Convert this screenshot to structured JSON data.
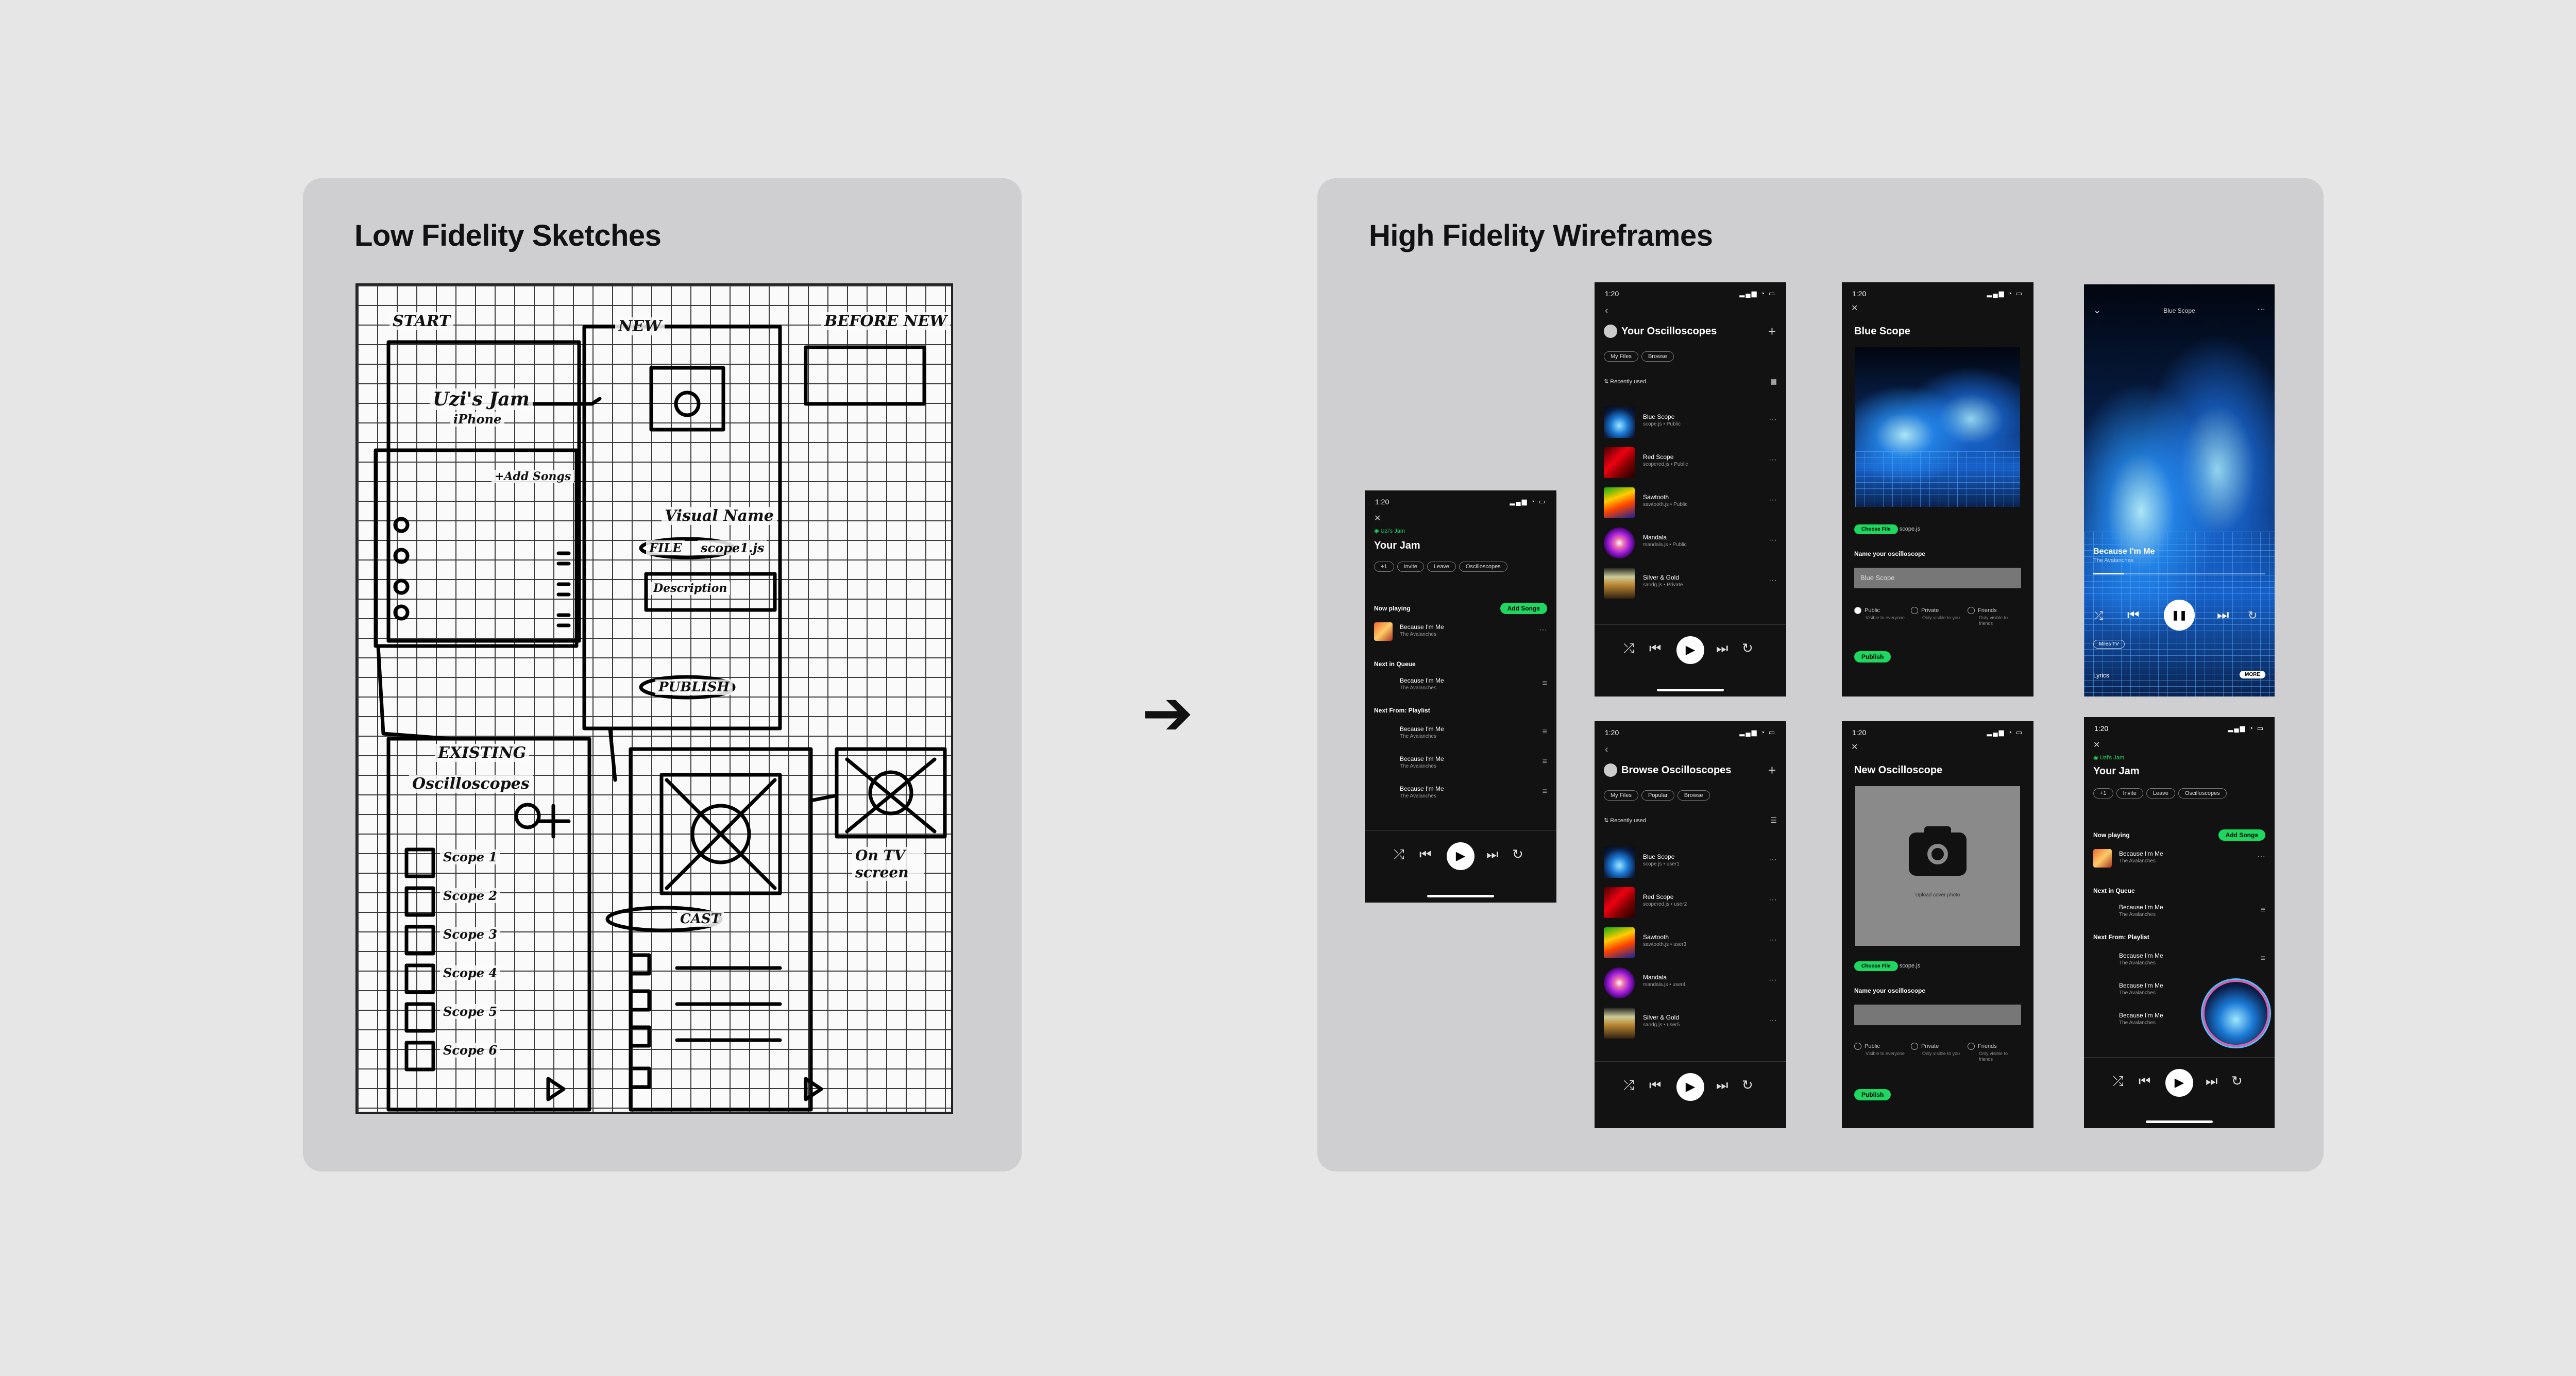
{
  "left": {
    "title": "Low Fidelity Sketches"
  },
  "right": {
    "title": "High Fidelity Wireframes"
  },
  "sketch": {
    "labels": {
      "start": "START",
      "new": "NEW",
      "before": "BEFORE NEW",
      "jam": "Uzi's Jam",
      "phone": "iPhone",
      "addsongs": "+Add Songs",
      "visual": "Visual Name",
      "file": "FILE",
      "scope": "scope1.js",
      "desc": "Description",
      "publish": "PUBLISH",
      "existing": "EXISTING",
      "osc": "Oscilloscopes",
      "cast": "CAST",
      "ontv": "On TV screen",
      "scopes": [
        "Scope 1",
        "Scope 2",
        "Scope 3",
        "Scope 4",
        "Scope 5",
        "Scope 6"
      ]
    }
  },
  "common": {
    "time": "1:20",
    "signal": "▂▄▆ ◔ ▭",
    "play": "▶",
    "pause": "❚❚",
    "prev": "⏮",
    "next": "⏭",
    "shuffle": "⤮",
    "repeat": "↻",
    "more": "···",
    "close": "✕",
    "plus": "+",
    "back": "‹",
    "chevron": "⌄"
  },
  "jam": {
    "host": "◉ Uzi's Jam",
    "title": "Your Jam",
    "chips": [
      "+1",
      "Invite",
      "Leave",
      "Oscilloscopes"
    ],
    "now_playing": "Now playing",
    "add_songs": "Add Songs",
    "next_queue": "Next in Queue",
    "next_playlist": "Next From: Playlist",
    "song": "Because I'm Me",
    "artist": "The Avalanches"
  },
  "your_osc": {
    "title": "Your Oscilloscopes",
    "chips": [
      "My Files",
      "Browse"
    ],
    "sort": "⇅ Recently used",
    "items": [
      {
        "name": "Blue Scope",
        "meta": "scope.js • Public"
      },
      {
        "name": "Red Scope",
        "meta": "scopered.js • Public"
      },
      {
        "name": "Sawtooth",
        "meta": "sawtooth.js • Public"
      },
      {
        "name": "Mandala",
        "meta": "mandala.js • Public"
      },
      {
        "name": "Silver & Gold",
        "meta": "sandg.js • Private"
      }
    ]
  },
  "browse_osc": {
    "title": "Browse Oscilloscopes",
    "chips": [
      "My Files",
      "Popular",
      "Browse"
    ],
    "sort": "⇅ Recently used",
    "items": [
      {
        "name": "Blue Scope",
        "meta": "scope.js • user1"
      },
      {
        "name": "Red Scope",
        "meta": "scopered.js • user2"
      },
      {
        "name": "Sawtooth",
        "meta": "sawtooth.js • user3"
      },
      {
        "name": "Mandala",
        "meta": "mandala.js • user4"
      },
      {
        "name": "Silver & Gold",
        "meta": "sandg.js • user5"
      }
    ]
  },
  "blue_scope": {
    "title": "Blue Scope",
    "choose_file": "Choose File",
    "file_name": "scope.js",
    "name_label": "Name your oscilloscope",
    "name_value": "Blue Scope",
    "public": "Public",
    "public_sub": "Visible to everyone",
    "private": "Private",
    "private_sub": "Only visible to you",
    "friends": "Friends",
    "friends_sub": "Only visible to friends",
    "publish": "Publish"
  },
  "new_osc": {
    "title": "New Oscilloscope",
    "upload": "Upload cover photo",
    "choose_file": "Choose File",
    "file_name": "scope.js",
    "name_label": "Name your oscilloscope",
    "public": "Public",
    "public_sub": "Visible to everyone",
    "private": "Private",
    "private_sub": "Only visible to you",
    "friends": "Friends",
    "friends_sub": "Only visible to friends",
    "publish": "Publish"
  },
  "full_player": {
    "header": "Blue Scope",
    "song": "Because I'm Me",
    "artist": "The Avalanches",
    "device": "Miles TV",
    "lyrics": "Lyrics",
    "more": "MORE",
    "progress": 0.18
  }
}
